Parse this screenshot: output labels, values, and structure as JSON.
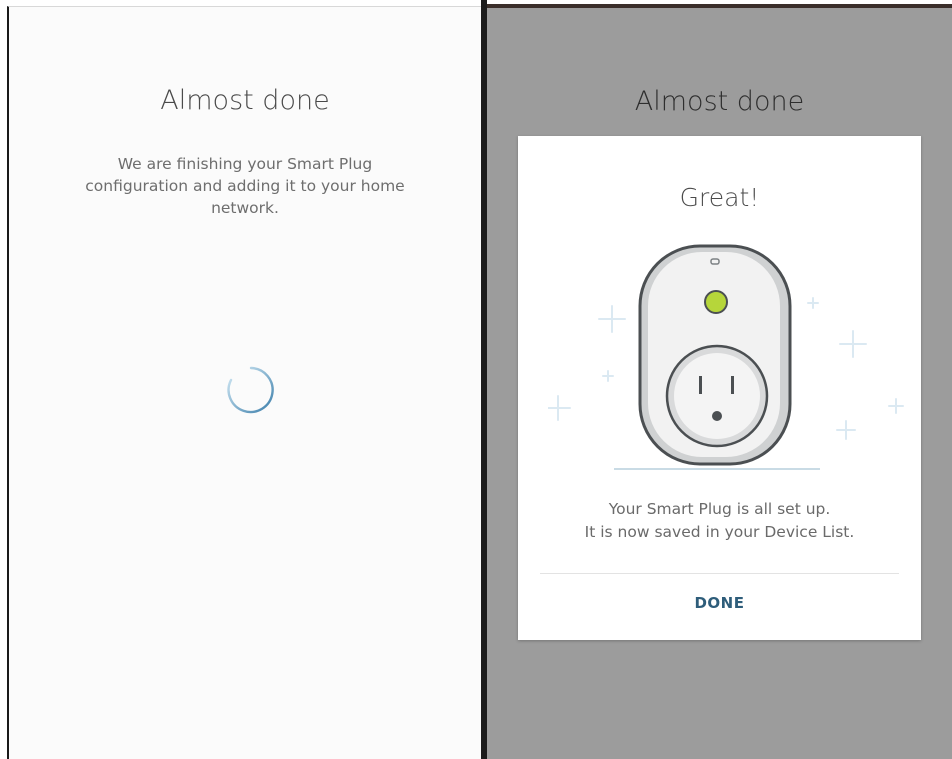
{
  "left_screen": {
    "title": "Almost done",
    "description": "We are finishing your Smart Plug configuration and adding it to your home network.",
    "spinner_icon": "loading-spinner-icon"
  },
  "right_screen": {
    "title": "Almost done",
    "dialog": {
      "title": "Great!",
      "illustration_icon": "smart-plug-icon",
      "message_line1": "Your Smart Plug is all set up.",
      "message_line2": "It is now saved in your Device List.",
      "done_label": "DONE"
    }
  },
  "colors": {
    "accent": "#2e5d7a",
    "led": "#b6d63a",
    "overlay": "#9c9c9c"
  }
}
